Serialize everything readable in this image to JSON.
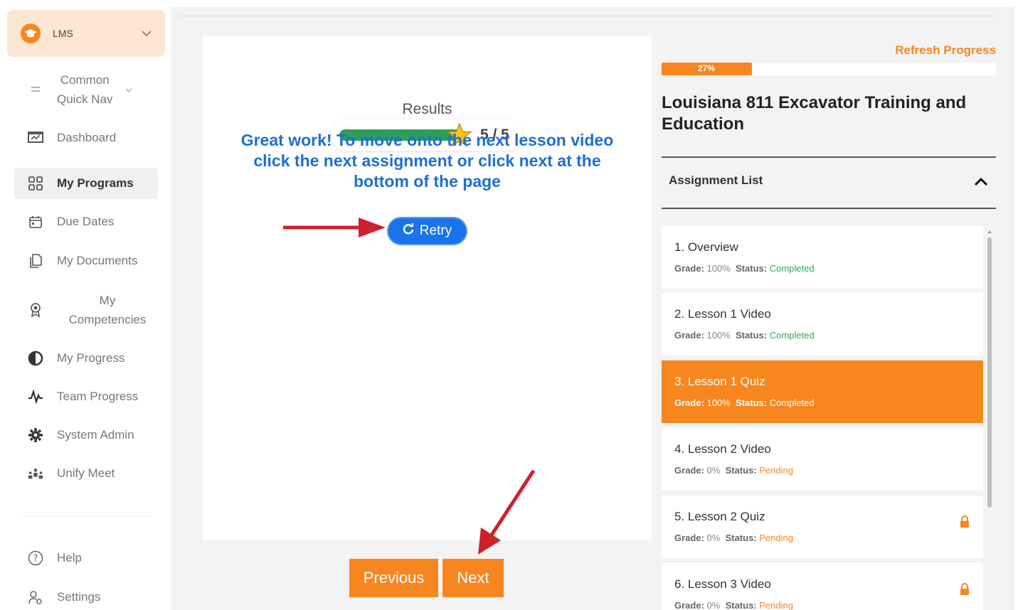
{
  "sidebar": {
    "lms_label": "LMS",
    "quick_nav": [
      "Common",
      "Quick Nav"
    ],
    "items": [
      {
        "label": "Dashboard"
      },
      {
        "label": "My Programs"
      },
      {
        "label": "Due Dates"
      },
      {
        "label": "My Documents"
      },
      {
        "label": "My",
        "label2": "Competencies"
      },
      {
        "label": "My Progress"
      },
      {
        "label": "Team Progress"
      },
      {
        "label": "System Admin"
      },
      {
        "label": "Unify Meet"
      }
    ],
    "footer": [
      {
        "label": "Help"
      },
      {
        "label": "Settings"
      }
    ]
  },
  "results": {
    "title": "Results",
    "score": "5 / 5",
    "score_fraction": 1.0,
    "message": "Great work! To move onto the next lesson video click the next assignment or click next at the bottom of the page",
    "retry_label": "Retry"
  },
  "navigation": {
    "previous_label": "Previous",
    "next_label": "Next"
  },
  "course": {
    "refresh_label": "Refresh Progress",
    "progress_text": "27%",
    "progress_fraction": 0.27,
    "title": "Louisiana 811 Excavator Training and Education",
    "assignment_list_label": "Assignment List"
  },
  "assignments": [
    {
      "title": "1. Overview",
      "grade_key": "Grade:",
      "grade": "100%",
      "status_key": "Status:",
      "status": "Completed",
      "current": false,
      "locked": false
    },
    {
      "title": "2. Lesson 1 Video",
      "grade_key": "Grade:",
      "grade": "100%",
      "status_key": "Status:",
      "status": "Completed",
      "current": false,
      "locked": false
    },
    {
      "title": "3. Lesson 1 Quiz",
      "grade_key": "Grade:",
      "grade": "100%",
      "status_key": "Status:",
      "status": "Completed",
      "current": true,
      "locked": false
    },
    {
      "title": "4. Lesson 2 Video",
      "grade_key": "Grade:",
      "grade": "0%",
      "status_key": "Status:",
      "status": "Pending",
      "current": false,
      "locked": false
    },
    {
      "title": "5. Lesson 2 Quiz",
      "grade_key": "Grade:",
      "grade": "0%",
      "status_key": "Status:",
      "status": "Pending",
      "current": false,
      "locked": true
    },
    {
      "title": "6. Lesson 3 Video",
      "grade_key": "Grade:",
      "grade": "0%",
      "status_key": "Status:",
      "status": "Pending",
      "current": false,
      "locked": true
    }
  ],
  "colors": {
    "accent": "#f7861f",
    "primary_blue": "#1a73e8",
    "completed_green": "#2eaa55",
    "score_bar": "#2f9e5a"
  }
}
